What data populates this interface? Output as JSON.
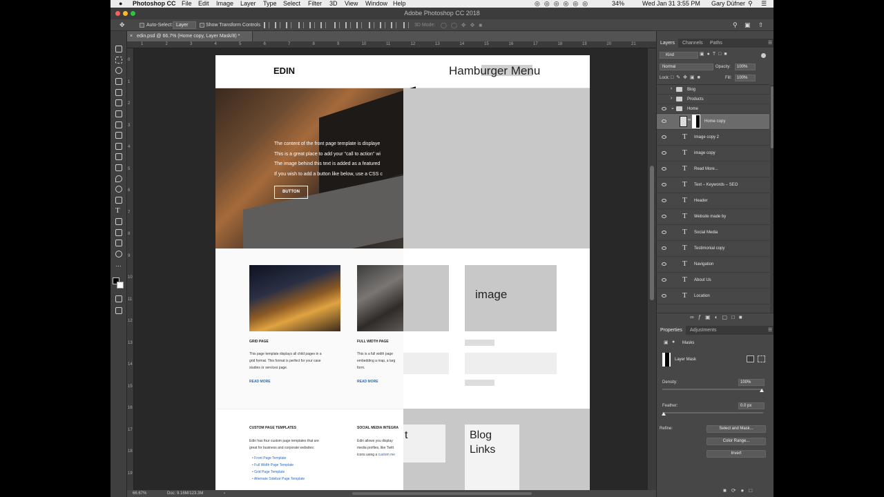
{
  "menubar": {
    "app_name": "Photoshop CC",
    "items": [
      "File",
      "Edit",
      "Image",
      "Layer",
      "Type",
      "Select",
      "Filter",
      "3D",
      "View",
      "Window",
      "Help"
    ],
    "battery": "34%",
    "datetime": "Wed Jan 31  3:55 PM",
    "user": "Gary Düfner"
  },
  "window": {
    "title": "Adobe Photoshop CC 2018"
  },
  "options": {
    "auto_select_label": "Auto-Select:",
    "auto_select_value": "Layer",
    "show_transform_label": "Show Transform Controls",
    "mode_3d_label": "3D Mode:"
  },
  "document": {
    "tab_title": "edin.psd @ 66.7% (Home copy, Layer Mask/8) *",
    "zoom": "66.67%",
    "doc_size": "Doc: 9.16M/123.3M",
    "ruler_top": [
      "1",
      "2",
      "3",
      "4",
      "5",
      "6",
      "7",
      "8",
      "9",
      "10",
      "11",
      "12",
      "13",
      "14",
      "15",
      "16",
      "17",
      "18",
      "19",
      "20",
      "21"
    ],
    "ruler_left": [
      "0",
      "1",
      "2",
      "3",
      "4",
      "5",
      "6",
      "7",
      "8",
      "9",
      "10",
      "11",
      "12",
      "13",
      "14",
      "15",
      "16",
      "17",
      "18",
      "19"
    ]
  },
  "canvas": {
    "logo": "EDIN",
    "hamburger": "Hamburger Menu",
    "hero_lines": [
      "The content of the front page template is displaye",
      "This is a great place to add your \"call to action\" wi",
      "The image behind this text is added as a featured",
      "If you wish to add a button like below, use a CSS c"
    ],
    "button": "BUTTON",
    "card1": {
      "title": "GRID PAGE",
      "text": [
        "This page template displays all child pages in a",
        "grid format. This format is perfect for your case",
        "studies or services page."
      ],
      "link": "READ MORE"
    },
    "card2": {
      "title": "FULL WIDTH PAGE",
      "text": [
        "This is a full width page",
        "embedding a map, a larg",
        "form."
      ],
      "link": "READ MORE"
    },
    "wire_image_label": "image",
    "footer1": {
      "title": "CUSTOM PAGE TEMPLATES",
      "text": [
        "Edin has four custom page templates that are",
        "great for business and corporate websites:"
      ],
      "list": [
        "Front Page Template",
        "Full Width Page Template",
        "Grid Page Template",
        "Alternate Sidebar Page Template"
      ]
    },
    "footer2": {
      "title": "SOCIAL MEDIA INTEGRA",
      "text": [
        "Edin allows you display",
        "media profiles, like Twitt",
        "icons using a "
      ],
      "link": "custom me"
    },
    "wire_t_label": "t",
    "blog_links": [
      "Blog",
      "Links"
    ]
  },
  "layers_panel": {
    "tabs": [
      "Layers",
      "Channels",
      "Paths"
    ],
    "kind_filter": "Kind",
    "blend_mode": "Normal",
    "opacity_label": "Opacity:",
    "opacity_value": "100%",
    "lock_label": "Lock:",
    "fill_label": "Fill:",
    "fill_value": "100%",
    "groups": [
      "Blog",
      "Products",
      "Home"
    ],
    "selected_layer": "Home copy",
    "text_layers": [
      "Image copy 2",
      "image copy",
      "Read More...",
      "Text – Keywords – SEO",
      "Header",
      "Website made by",
      "Social Media",
      "Testimonial copy",
      "Navigation",
      "About Us",
      "Location"
    ]
  },
  "properties_panel": {
    "tabs": [
      "Properties",
      "Adjustments"
    ],
    "masks_label": "Masks",
    "layer_mask_label": "Layer Mask",
    "density_label": "Density:",
    "density_value": "100%",
    "feather_label": "Feather:",
    "feather_value": "0.0 px",
    "refine_label": "Refine:",
    "buttons": [
      "Select and Mask...",
      "Color Range...",
      "Invert"
    ]
  },
  "colors": {
    "ps_dark": "#535353",
    "panel": "#474747",
    "wire_gray": "#c8c8c8",
    "link_blue": "#2a6ab3"
  }
}
